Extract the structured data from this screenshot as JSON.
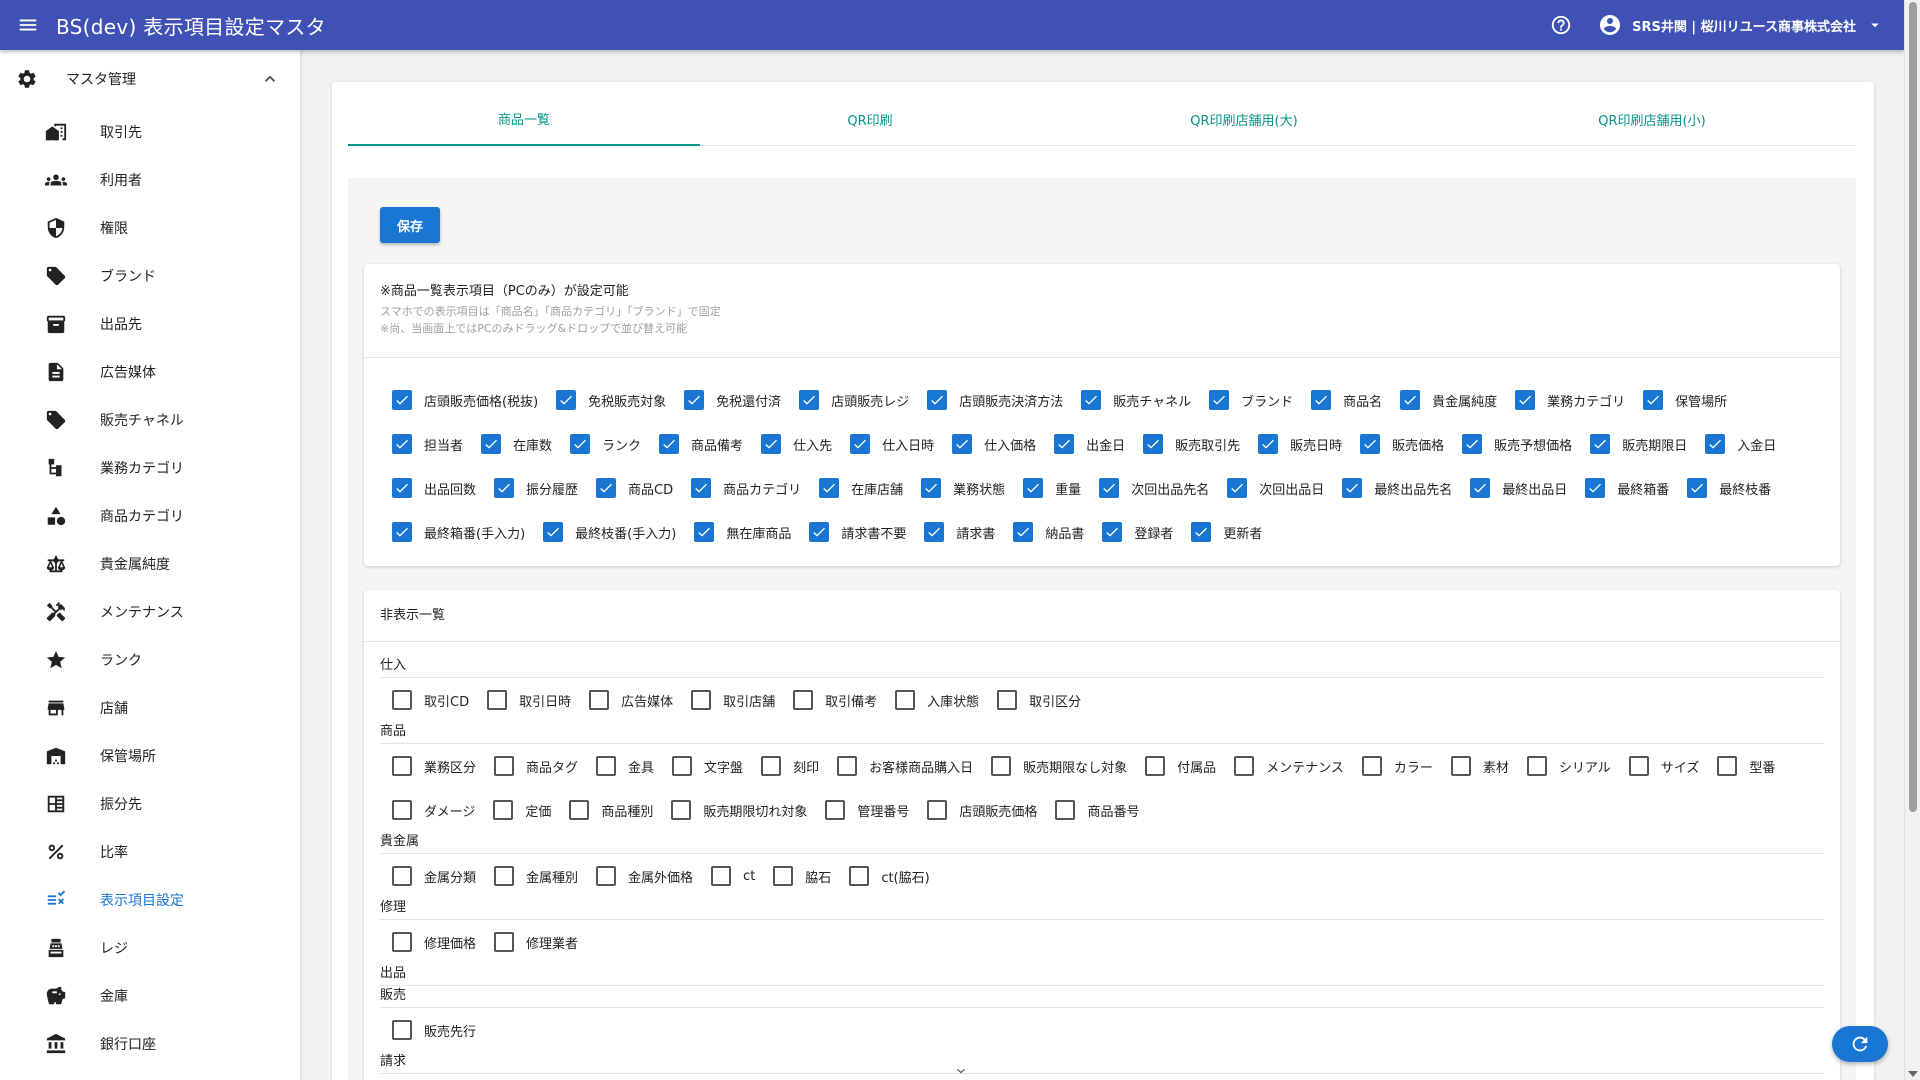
{
  "app": {
    "title": "BS(dev) 表示項目設定マスタ",
    "user": "SRS井関 | 桜川リユース商事株式会社",
    "accent": "#3f51b5",
    "primary": "#1976d2",
    "tab_color": "#009688"
  },
  "sidebar": {
    "group": {
      "label": "マスタ管理",
      "icon": "gear-icon"
    },
    "items": [
      {
        "label": "取引先",
        "icon": "building-icon"
      },
      {
        "label": "利用者",
        "icon": "people-icon"
      },
      {
        "label": "権限",
        "icon": "shield-icon"
      },
      {
        "label": "ブランド",
        "icon": "tag-icon"
      },
      {
        "label": "出品先",
        "icon": "archive-icon"
      },
      {
        "label": "広告媒体",
        "icon": "document-icon"
      },
      {
        "label": "販売チャネル",
        "icon": "tag-icon"
      },
      {
        "label": "業務カテゴリ",
        "icon": "tree-icon"
      },
      {
        "label": "商品カテゴリ",
        "icon": "shapes-icon"
      },
      {
        "label": "貴金属純度",
        "icon": "scale-icon"
      },
      {
        "label": "メンテナンス",
        "icon": "tools-icon"
      },
      {
        "label": "ランク",
        "icon": "star-icon"
      },
      {
        "label": "店舗",
        "icon": "store-icon"
      },
      {
        "label": "保管場所",
        "icon": "warehouse-icon"
      },
      {
        "label": "振分先",
        "icon": "table-icon"
      },
      {
        "label": "比率",
        "icon": "percent-icon"
      },
      {
        "label": "表示項目設定",
        "icon": "checklist-icon",
        "active": true
      },
      {
        "label": "レジ",
        "icon": "register-icon"
      },
      {
        "label": "金庫",
        "icon": "piggybank-icon"
      },
      {
        "label": "銀行口座",
        "icon": "bank-icon"
      }
    ]
  },
  "tabs": [
    {
      "label": "商品一覧",
      "active": true
    },
    {
      "label": "QR印刷"
    },
    {
      "label": "QR印刷店舗用(大)"
    },
    {
      "label": "QR印刷店舗用(小)"
    }
  ],
  "toolbar": {
    "save_label": "保存"
  },
  "display_section": {
    "heading": "※商品一覧表示項目（PCのみ）が設定可能",
    "note1": "スマホでの表示項目は「商品名」「商品カテゴリ」「ブランド」で固定",
    "note2": "※尚、当画面上ではPCのみドラッグ&ドロップで並び替え可能",
    "items": [
      "店頭販売価格(税抜)",
      "免税販売対象",
      "免税還付済",
      "店頭販売レジ",
      "店頭販売決済方法",
      "販売チャネル",
      "ブランド",
      "商品名",
      "貴金属純度",
      "業務カテゴリ",
      "保管場所",
      "担当者",
      "在庫数",
      "ランク",
      "商品備考",
      "仕入先",
      "仕入日時",
      "仕入価格",
      "出金日",
      "販売取引先",
      "販売日時",
      "販売価格",
      "販売予想価格",
      "販売期限日",
      "入金日",
      "出品回数",
      "振分履歴",
      "商品CD",
      "商品カテゴリ",
      "在庫店舗",
      "業務状態",
      "重量",
      "次回出品先名",
      "次回出品日",
      "最終出品先名",
      "最終出品日",
      "最終箱番",
      "最終枝番",
      "最終箱番(手入力)",
      "最終枝番(手入力)",
      "無在庫商品",
      "請求書不要",
      "請求書",
      "納品書",
      "登録者",
      "更新者"
    ]
  },
  "hidden_section": {
    "heading": "非表示一覧",
    "categories": [
      {
        "title": "仕入",
        "items": [
          "取引CD",
          "取引日時",
          "広告媒体",
          "取引店舗",
          "取引備考",
          "入庫状態",
          "取引区分"
        ]
      },
      {
        "title": "商品",
        "items": [
          "業務区分",
          "商品タグ",
          "金具",
          "文字盤",
          "刻印",
          "お客様商品購入日",
          "販売期限なし対象",
          "付属品",
          "メンテナンス",
          "カラー",
          "素材",
          "シリアル",
          "サイズ",
          "型番",
          "ダメージ",
          "定価",
          "商品種別",
          "販売期限切れ対象",
          "管理番号",
          "店頭販売価格",
          "商品番号"
        ]
      },
      {
        "title": "貴金属",
        "items": [
          "金属分類",
          "金属種別",
          "金属外価格",
          "ct",
          "脇石",
          "ct(脇石)"
        ]
      },
      {
        "title": "修理",
        "items": [
          "修理価格",
          "修理業者"
        ]
      },
      {
        "title": "出品",
        "items": []
      },
      {
        "title": "販売",
        "items": [
          "販売先行"
        ]
      },
      {
        "title": "請求",
        "items": []
      }
    ]
  }
}
